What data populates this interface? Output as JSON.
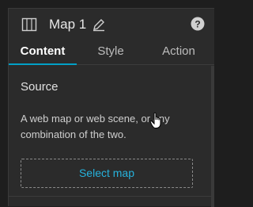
{
  "header": {
    "title": "Map 1",
    "icons": {
      "map": "map-icon",
      "edit": "pencil-icon",
      "help": "help-icon"
    }
  },
  "tabs": [
    {
      "label": "Content",
      "active": true
    },
    {
      "label": "Style",
      "active": false
    },
    {
      "label": "Action",
      "active": false
    }
  ],
  "source": {
    "title": "Source",
    "description": "A web map or web scene, or any combination of the two.",
    "button_label": "Select map"
  },
  "colors": {
    "accent": "#00a0c6",
    "link": "#26b2dc",
    "panel_bg": "#2b2b2b"
  }
}
